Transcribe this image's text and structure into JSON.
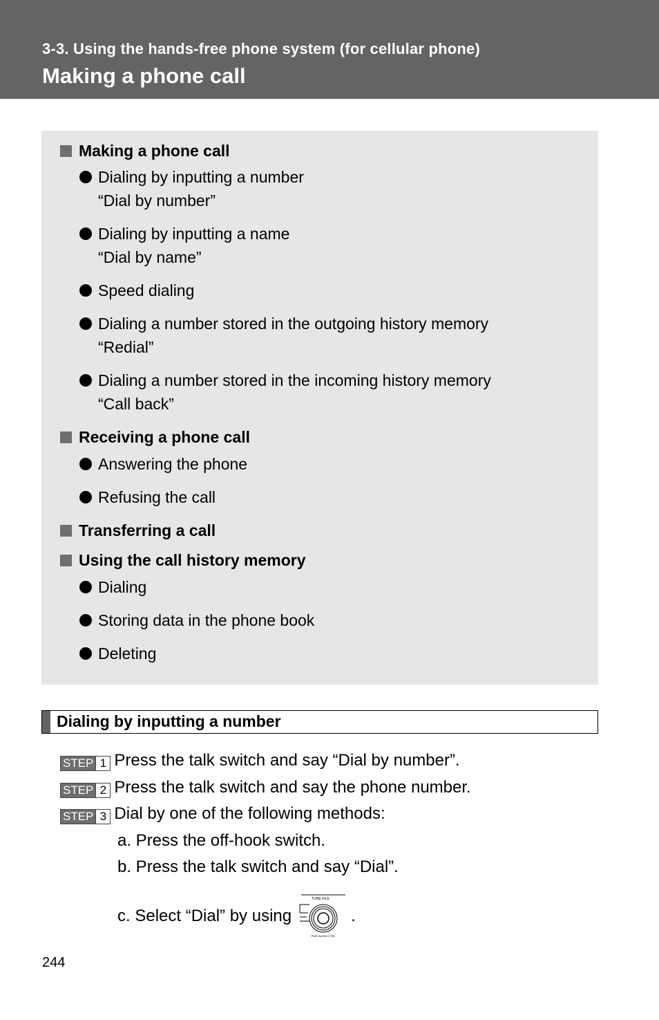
{
  "header": {
    "section_label": "3-3. Using the hands-free phone system (for cellular phone)",
    "page_title": "Making a phone call"
  },
  "summary": {
    "groups": [
      {
        "heading": "Making a phone call",
        "items": [
          {
            "label": "Dialing by inputting a number",
            "sub": "“Dial by number”"
          },
          {
            "label": "Dialing by inputting a name",
            "sub": "“Dial by name”"
          },
          {
            "label": "Speed dialing"
          },
          {
            "label": "Dialing a number stored in the outgoing history memory",
            "sub": "“Redial”"
          },
          {
            "label": "Dialing a number stored in the incoming history memory",
            "sub": "“Call back”"
          }
        ]
      },
      {
        "heading": "Receiving a phone call",
        "items": [
          {
            "label": "Answering the phone"
          },
          {
            "label": "Refusing the call"
          }
        ]
      },
      {
        "heading": "Transferring a call",
        "items": []
      },
      {
        "heading": "Using the call history memory",
        "items": [
          {
            "label": "Dialing"
          },
          {
            "label": "Storing data in the phone book"
          },
          {
            "label": "Deleting"
          }
        ]
      }
    ]
  },
  "subsection": {
    "title": "Dialing by inputting a number"
  },
  "steps": [
    {
      "badge": "STEP",
      "number": "1",
      "text": "Press the talk switch and say “Dial by number”."
    },
    {
      "badge": "STEP",
      "number": "2",
      "text": "Press the talk switch and say the phone number."
    },
    {
      "badge": "STEP",
      "number": "3",
      "text": "Dial by one of the following methods:"
    }
  ],
  "methods": {
    "a": "a. Press the off-hook switch.",
    "b": "b. Press the talk switch and say “Dial”.",
    "c_prefix": "c. Select “Dial” by using",
    "c_suffix": ".",
    "knob_icon": "tune-file-knob-icon",
    "knob_top_label": "TUNE·FILE",
    "knob_bottom_label": "PWR·AUDIO CTRL"
  },
  "footer": {
    "page_number": "244"
  },
  "colors": {
    "header_bg": "#646464",
    "box_bg": "#e6e6e6",
    "badge_bg": "#6e6e6e"
  }
}
